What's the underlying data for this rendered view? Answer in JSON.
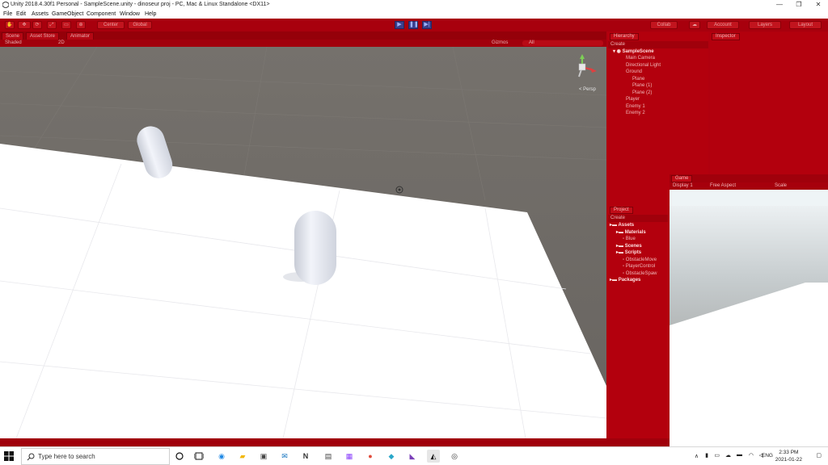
{
  "window": {
    "title": "Unity 2018.4.30f1 Personal - SampleScene.unity - dinoseur proj - PC, Mac & Linux Standalone <DX11>",
    "controls": [
      "—",
      "❐",
      "✕"
    ]
  },
  "menu": [
    "File",
    "Edit",
    "Assets",
    "GameObject",
    "Component",
    "Window",
    "Help"
  ],
  "toolbar": {
    "pivot_label": "Center",
    "space_label": "Global",
    "collab_label": "Collab",
    "account_label": "Account",
    "layers_label": "Layers",
    "layout_label": "Layout",
    "play_icon": "▶",
    "pause_icon": "❚❚",
    "step_icon": "▶|"
  },
  "scene": {
    "tabs": [
      "Scene",
      "Asset Store",
      "Animator"
    ],
    "shading_mode": "Shaded",
    "dim_label": "2D",
    "gizmos_label": "Gizmos",
    "search_placeholder": "All",
    "persp_label": "< Persp"
  },
  "hierarchy": {
    "tab_label": "Hierarchy",
    "create_label": "Create",
    "scene_name": "SampleScene",
    "items": [
      {
        "label": "Main Camera",
        "indent": 1
      },
      {
        "label": "Directional Light",
        "indent": 1
      },
      {
        "label": "Ground",
        "indent": 1
      },
      {
        "label": "Plane",
        "indent": 2
      },
      {
        "label": "Plane (1)",
        "indent": 2
      },
      {
        "label": "Plane (2)",
        "indent": 2
      },
      {
        "label": "Player",
        "indent": 1
      },
      {
        "label": "Enemy 1",
        "indent": 1
      },
      {
        "label": "Enemy 2",
        "indent": 1
      }
    ]
  },
  "inspector": {
    "tab_label": "Inspector"
  },
  "project": {
    "tab_label": "Project",
    "create_label": "Create",
    "items": [
      {
        "label": "Assets",
        "indent": 0,
        "folder": true
      },
      {
        "label": "Materials",
        "indent": 1,
        "folder": true
      },
      {
        "label": "Blue",
        "indent": 2,
        "folder": false
      },
      {
        "label": "Scenes",
        "indent": 1,
        "folder": true
      },
      {
        "label": "Scripts",
        "indent": 1,
        "folder": true
      },
      {
        "label": "ObstacleMove",
        "indent": 2,
        "folder": false
      },
      {
        "label": "PlayerControl",
        "indent": 2,
        "folder": false
      },
      {
        "label": "ObstacleSpaw",
        "indent": 2,
        "folder": false
      },
      {
        "label": "Packages",
        "indent": 0,
        "folder": true
      }
    ]
  },
  "game": {
    "tab_label": "Game",
    "display_label": "Display 1",
    "aspect_label": "Free Aspect",
    "scale_label": "Scale"
  },
  "taskbar": {
    "search_placeholder": "Type here to search",
    "language": "ENG",
    "time": "2:33 PM",
    "date": "2021-01-22"
  },
  "colors": {
    "play_mode_tint": "#b0000e",
    "scene_background": "#6f6b66",
    "ground": "#ffffff"
  }
}
